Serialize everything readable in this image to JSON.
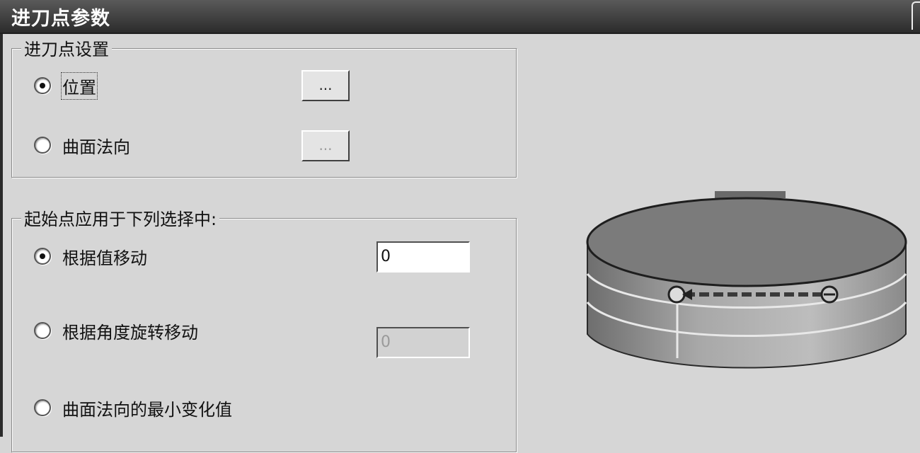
{
  "window": {
    "title": "进刀点参数"
  },
  "entry_settings": {
    "legend": "进刀点设置",
    "options": [
      {
        "label": "位置",
        "checked": true,
        "button_label": "...",
        "button_enabled": true
      },
      {
        "label": "曲面法向",
        "checked": false,
        "button_label": "...",
        "button_enabled": false
      }
    ]
  },
  "start_point": {
    "legend": "起始点应用于下列选择中:",
    "options": [
      {
        "label": "根据值移动",
        "checked": true,
        "value": "0",
        "enabled": true
      },
      {
        "label": "根据角度旋转移动",
        "checked": false,
        "value": "0",
        "enabled": false
      },
      {
        "label": "曲面法向的最小变化值",
        "checked": false
      }
    ]
  },
  "colors": {
    "titlebar": "#3a3a3a",
    "background": "#d6d6d6",
    "cylinder_top": "#7a7a7a",
    "cylinder_side": "#9e9e9e"
  },
  "icons": {
    "preview": "cylinder-entry-point-illustration"
  }
}
